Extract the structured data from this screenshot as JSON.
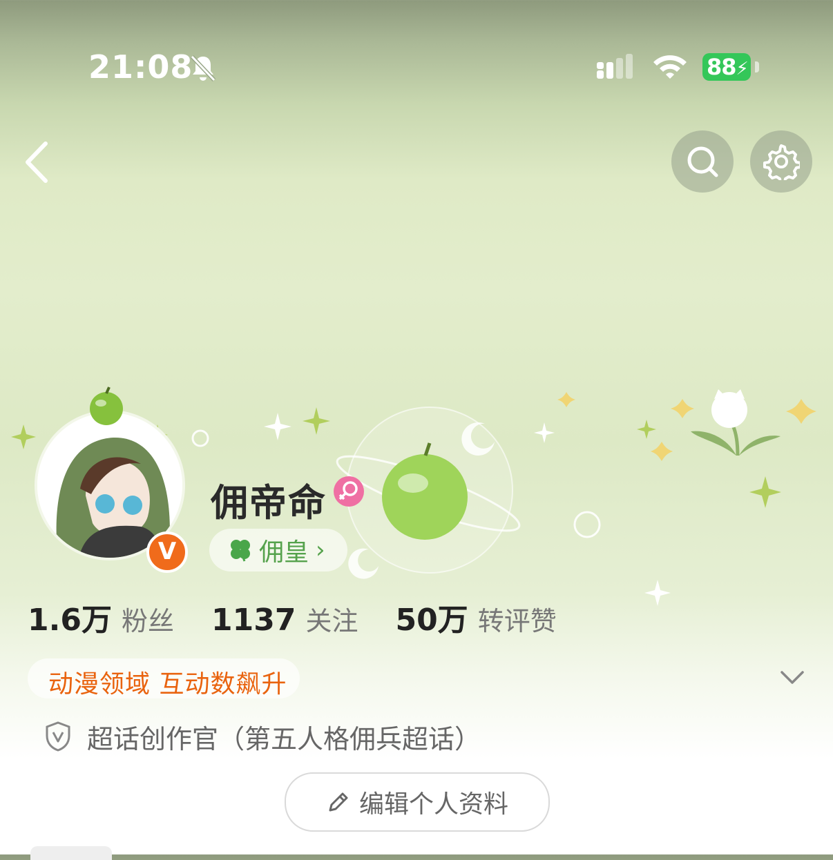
{
  "status_bar": {
    "time": "21:08",
    "battery": "88"
  },
  "header": {
    "back_icon": "chevron-left-icon",
    "search_icon": "search-icon",
    "settings_icon": "gear-icon"
  },
  "profile": {
    "username": "佣帝命",
    "verified_badge": "V",
    "tag_label": "佣皇",
    "tag_arrow": "›",
    "stats": [
      {
        "value": "1.6万",
        "label": "粉丝"
      },
      {
        "value": "1137",
        "label": "关注"
      },
      {
        "value": "50万",
        "label": "转评赞"
      }
    ],
    "hot_badge": "动漫领域 互动数飙升",
    "verification": "超话创作官（第五人格佣兵超话）",
    "edit_button": "编辑个人资料"
  },
  "colors": {
    "accent_orange": "#e9630f",
    "tag_green": "#55a24c",
    "battery_green": "#34c759",
    "gender_pink": "#ef6fa3"
  }
}
